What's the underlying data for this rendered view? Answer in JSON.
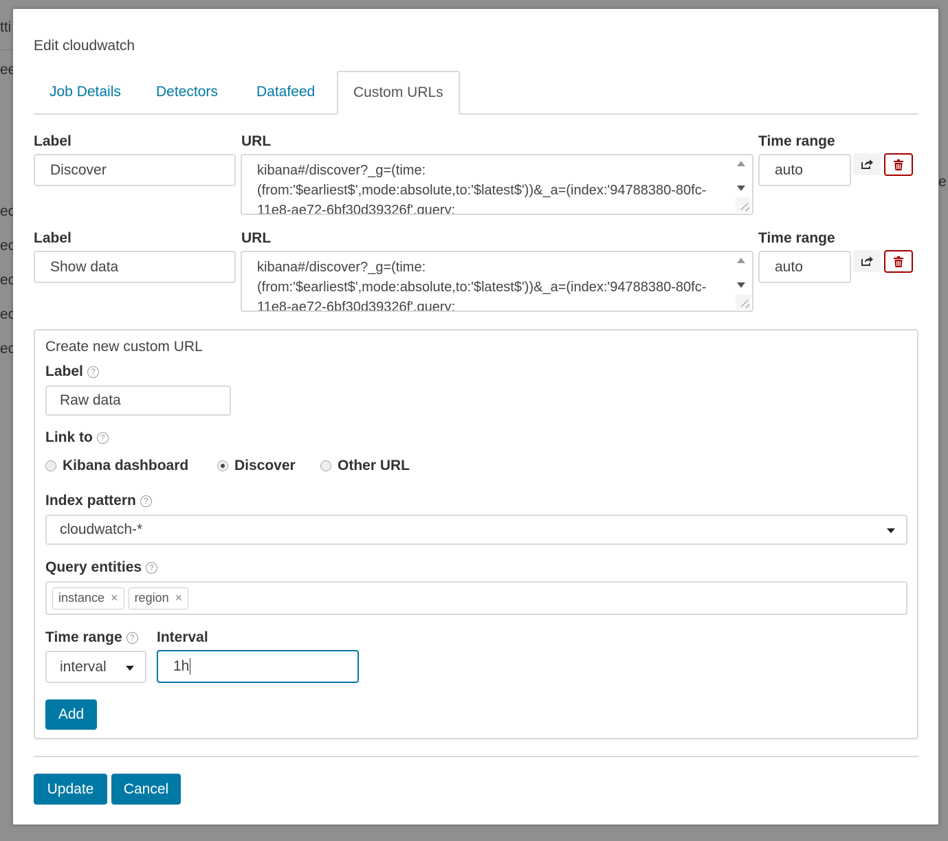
{
  "background": {
    "frag1": "tti",
    "frag2": "ee",
    "frag3": "ect",
    "frag4": "ect",
    "frag5": "ect",
    "frag6": "ect",
    "frag7": "ect",
    "frag8": "e"
  },
  "modal": {
    "title": "Edit cloudwatch",
    "tabs": [
      {
        "label": "Job Details",
        "active": false
      },
      {
        "label": "Detectors",
        "active": false
      },
      {
        "label": "Datafeed",
        "active": false
      },
      {
        "label": "Custom URLs",
        "active": true
      }
    ],
    "field_labels": {
      "label": "Label",
      "url": "URL",
      "time_range": "Time range"
    },
    "custom_urls": [
      {
        "label": "Discover",
        "url": "kibana#/discover?_g=(time:(from:'$earliest$',mode:absolute,to:'$latest$'))&_a=(index:'94788380-80fc-11e8-ae72-6bf30d39326f',query:",
        "time_range": "auto"
      },
      {
        "label": "Show data",
        "url": "kibana#/discover?_g=(time:(from:'$earliest$',mode:absolute,to:'$latest$'))&_a=(index:'94788380-80fc-11e8-ae72-6bf30d39326f',query:",
        "time_range": "auto"
      }
    ],
    "new_url": {
      "title": "Create new custom URL",
      "label_label": "Label",
      "label_value": "Raw data",
      "link_to_label": "Link to",
      "link_options": [
        {
          "label": "Kibana dashboard",
          "checked": false
        },
        {
          "label": "Discover",
          "checked": true
        },
        {
          "label": "Other URL",
          "checked": false
        }
      ],
      "index_pattern_label": "Index pattern",
      "index_pattern_value": "cloudwatch-*",
      "query_entities_label": "Query entities",
      "query_entities": [
        "instance",
        "region"
      ],
      "time_range_label": "Time range",
      "time_range_value": "interval",
      "interval_label": "Interval",
      "interval_value": "1h",
      "add_label": "Add"
    },
    "footer": {
      "update_label": "Update",
      "cancel_label": "Cancel"
    }
  },
  "icons": {
    "share": "share-icon",
    "trash": "trash-icon",
    "help": "help-icon",
    "remove": "close-icon",
    "caret": "caret-down-icon"
  },
  "colors": {
    "primary": "#0079a5",
    "danger": "#a30000",
    "border": "#d9d9d9"
  }
}
